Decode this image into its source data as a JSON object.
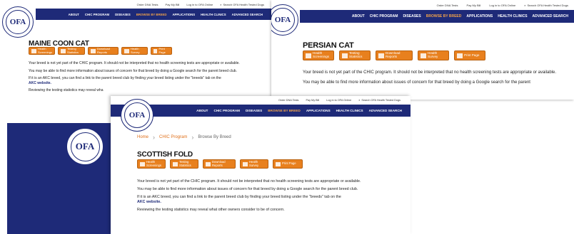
{
  "util_links": [
    "Order DNA Tests",
    "Pay My Bill",
    "Log in to OFA Online"
  ],
  "search_label": "Search OFA Health Tested Dogs",
  "logo_text": "OFA",
  "nav": [
    "ABOUT",
    "CHIC PROGRAM",
    "DISEASES",
    "BROWSE BY BREED",
    "APPLICATIONS",
    "HEALTH CLINICS",
    "ADVANCED SEARCH"
  ],
  "buttons": [
    {
      "line1": "Health",
      "line2": "Screenings"
    },
    {
      "line1": "Testing",
      "line2": "Statistics"
    },
    {
      "line1": "Download",
      "line2": "Reports"
    },
    {
      "line1": "Health",
      "line2": "Survey"
    },
    {
      "line1": "Print Page",
      "line2": ""
    }
  ],
  "breadcrumb": [
    "Home",
    "CHIC Program",
    "Browse By Breed"
  ],
  "panel1": {
    "title": "MAINE COON CAT",
    "p1": "Your breed is not yet part of the CHIC program. It should not be interpreted that no health screening tests are appropriate or available.",
    "p2": "You may be able to find more information about issues of concern for that breed by doing a Google search for the parent breed club.",
    "p3a": "If it is an AKC breed, you can find a link to the parent breed club by finding your breed listing under the \"breeds\" tab on the",
    "p3b": "AKC website.",
    "p4": "Reviewing the testing statistics may reveal wha"
  },
  "panel2": {
    "title": "PERSIAN CAT",
    "p1": "Your breed is not yet part of the CHIC program. It should not be interpreted that no health screening tests are appropriate or available.",
    "p2": "You may be able to find more information about issues of concern for that breed by doing a Google search for the parent"
  },
  "panel3": {
    "title": "SCOTTISH FOLD",
    "p1": "Your breed is not yet part of the CHIC program. It should not be interpreted that no health screening tests are appropriate or available.",
    "p2": "You may be able to find more information about issues of concern for that breed by doing a Google search for the parent breed club.",
    "p3a": "If it is an AKC breed, you can find a link to the parent breed club by finding your breed listing under the \"breeds\" tab on the",
    "p3b": "AKC website.",
    "p4": "Reviewing the testing statistics may reveal what other owners consider to be of concern."
  }
}
